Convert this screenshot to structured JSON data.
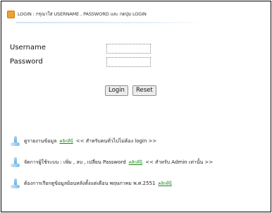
{
  "header": {
    "icon": "login-icon",
    "text": "LOGIN : กรุณาใส่ USERNAME , PASSWORD และ กดปุ่ม LOGIN"
  },
  "form": {
    "username_label": "Username",
    "password_label": "Password",
    "username_value": "",
    "password_value": "",
    "login_button": "Login",
    "reset_button": "Reset"
  },
  "links": [
    {
      "icon": "bullet-icon",
      "text": "ดูรายงานข้อมูล",
      "link": "คลิกที่นี่",
      "note": "<< สำหรับคนทั่วไปไม่ต้อง login >>"
    },
    {
      "icon": "bullet-icon",
      "text": "จัดการผู้ใช้ระบบ : เพิ่ม , ลบ , เปลี่ยน Password",
      "link": "คลิกที่นี่",
      "note": "<< สำหรับ Admin เท่านั้น >>"
    },
    {
      "icon": "bullet-icon",
      "text": "ต้องการเรียกดูข้อมูลย้อนหลังตั้งแต่เดือน พฤษภาคม พ.ศ.2551",
      "link": "คลิกที่นี่",
      "note": ""
    }
  ],
  "colors": {
    "header_icon": "#f0a22e",
    "link": "#1a8a1a",
    "bullet": "#5ea8de"
  }
}
